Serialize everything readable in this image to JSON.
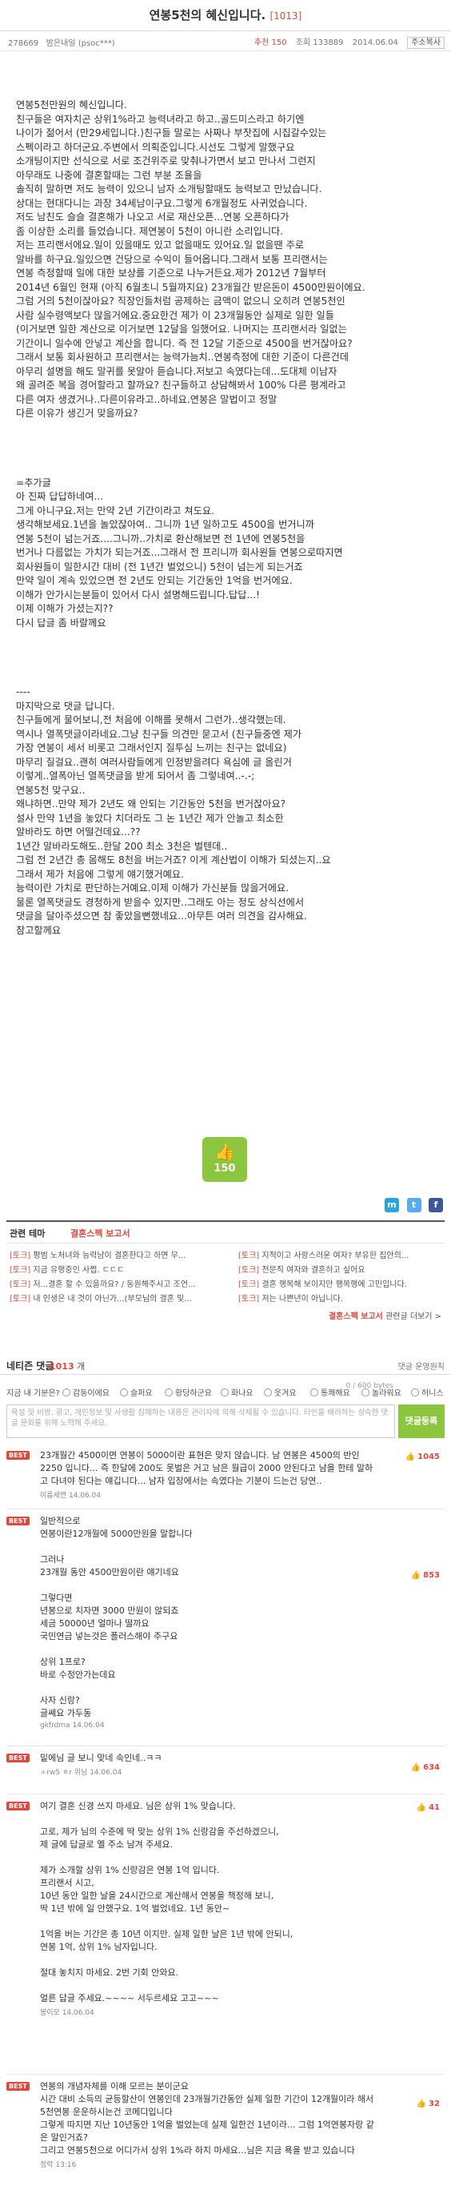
{
  "post": {
    "title": "연봉5천의 혜신입니다.",
    "count_badge": "[1013]",
    "id": "278669",
    "author": "밤은내일 (psoc***)",
    "recommend": "추천 150",
    "views": "조회 133889",
    "date": "2014.06.04",
    "copy_label": "주소복사"
  },
  "article": [
    "연봉5천만원의 혜신입니다.\n친구들은 여자치곤 상위1%라고 능력녀라고 하고..골드미스라고 하기엔\n나이가 젊어서 (만29세입니다.)친구들 말로는 사짜나 부잣집에 시집갈수있는\n스펙이라고 하더군요.주변에서 의획준입니다.시선도 그렇게 말했구요\n소개팅이지만 선식으로 서로 조건위주로 맞춰나가면서 보고 만나서 그런지\n아무래도 나중에 결혼할때는 그런 부분 조율을\n솔직히 말하면 저도 능력이 있으니 남자 소개팅할때도 능력보고 만났습니다.\n상대는 현대다니는 과장 34세남이구요.그렇게 6개월정도 사귀었습니다.\n저도 남친도 슬슬 결혼해가 나오고 서로 재산오픈...연봉 오픈하다가\n좀 이상한 소리를 들었습니다. 제연봉이 5천이 아니란 소리입니다.\n저는 프리랜서에요.일이 있을때도 있고 없을때도 있어요.일 없을땐 주로\n알바를 하구요.일있으면 건당으로 수익이 들어옵니다.그래서 보통 프리랜서는\n연봉 측정할때 일에 대한 보상를 기준으로 나누거든요.제가 2012년 7월부터\n2014년 6월인 현재 (아직 6월초니 5월까지요) 23개월간 받은돈이 4500만원이에요.\n그럼 거의 5천이잖아요? 직장인들처럼 공제하는 금액이 없으니 오히려 연봉5천인\n사람 실수령액보다 많을거에요.중요한건 제가 이 23개월동안 실제로 일한 일들\n(이거보면 일한 계산으로 이거보면 12달을 일했어요. 나머지는 프리랜서라 일없는\n기간이니 일수에 안넣고 계산을 합니다. 즉 전 12달 기준으로 4500을 번거잖아요?\n그래서 보통 회사원하고 프리랜서는 능력가늠치..연봉측정에 대한 기준이 다른건데\n아무리 설명을 해도 말귀를 못알아 듣습니다.저보고 속였다는데...도대체 이남자\n왜 골려준 복을 경어할라고 할까요? 친구들하고 상담해봐서 100% 다른 평계라고\n다른 여자 생겼거나..다른이유라고..하네요.연봉은 말법이고 정말\n다른 이유가 생긴거 맞을까요?",
    "=추가글\n아 진짜 답답하네여...\n그게 아니구요.저는 만약 2년 기간이라고 쳐도요.\n생각해보세요.1년을 놀았잖아여.. 그니까 1년 일하고도 4500을 번거니까\n연봉 5천이 넘는거죠....그니까..가치로 환산해보면 전 1년에 연봉5천을\n번거나 다름없는 가치가 되는거죠...그래서 전 프리니까 회사원들 연봉으로따지면\n회사원들이 일한시간 대비 (전 1년간 벌었으니) 5천이 넘는게 되는거죠\n만약 일이 계속 있었으면 전 2년도 안되는 기간동안 1억을 번거에요.\n이해가 안가시는분들이 있어서 다시 설명해드립니다.답답...!\n이제 이해가 가셨는지??\n다시 답글 좀 바랄께요",
    "----\n마지막으로 댓글 답니다.\n친구들에게 물어보니,전 처음에 이해를 못해서 그런가..생각했는데.\n역시나 열폭댓글이라네요.그냥 친구들 의견만 묻고서 (친구들중엔 제가\n가장 연봉이 세서 비롯고 그래서인지 질투심 느끼는 친구는 없네요)\n마무리 질걸요..괜히 여러사람들에게 인정받을려다 욕심에 글 올린거\n이렇게..열폭아닌 열폭댓글을 받게 되어서 좀 그렇네여..-.-;\n연봉5천 맞구요..\n왜냐하면..만약 제가 2년도 왜 안되는 기간동안 5천을 번거잖아요?\n설사 만약 1년을 놓았다 치더라도 그 논 1년간 제가 안놀고 최소한\n알바라도 하면 어떨건데요...??\n1년간 알바라도해도..한달 200 최소 3천은 벌텐데..\n그럼 전 2년간 총 몸해도 8천을 버는거죠? 이게 계산법이 이해가 되셨는지..요\n그래서 제가 처음에 그렇게 얘기했거예요.\n능력이란 가치로 판단하는거예요.이제 이해가 가신분들 많을거에요.\n물론 열폭댓글도 경청하게 받을수 있지만..그래도 아는 정도 상식선에서\n댓글을 달아주셨으면 참 좋았을뻔했네요...아무튼 여러 의견을 감사해요.\n참고할께요"
  ],
  "recommend_button": {
    "count": "150"
  },
  "related": {
    "label": "관련 테마",
    "theme": "결혼스펙 보고서",
    "items": [
      {
        "tag": "[토크]",
        "text": "평범 노처녀와 능력남이 결혼한다고 하면 무..."
      },
      {
        "tag": "[토크]",
        "text": "지금 유행중인 사쩝. ㄷㄷㄷ"
      },
      {
        "tag": "[토크]",
        "text": "저...결혼 할 수 있을까요? / 동원해주시고 조언..."
      },
      {
        "tag": "[토크]",
        "text": "내 인생은 내 것이 아닌가...(부모님의 결혼 및..."
      }
    ],
    "items_right": [
      {
        "tag": "[토크]",
        "text": "지적이고 사랑스러운 여자? 부유한 집안의..."
      },
      {
        "tag": "[토크]",
        "text": "전문직 여자와 결혼하고 싶어요"
      },
      {
        "tag": "[토크]",
        "text": "결혼 행복해 보이지만 행복행에 고민입니다."
      },
      {
        "tag": "[토크]",
        "text": "저는 나쁜년이 아닙니다."
      }
    ],
    "footer_theme": "결혼스펙 보고서",
    "footer_more": "관련글 더보기 >"
  },
  "comments_head": {
    "title": "네티즌 댓글",
    "count": "1013",
    "unit": "개",
    "right": "댓글 운영원칙"
  },
  "mood": {
    "label": "지금 내 기분은?",
    "options": [
      "감동이에요",
      "슬퍼요",
      "황당하군요",
      "화나요",
      "웃겨요",
      "통쾌해요",
      "놀라워요",
      "허니스"
    ]
  },
  "write": {
    "placeholder": "욕설 및 비방, 광고, 개인정보 및 사생활 침해하는 내용은 관리자에 의해 삭제될 수 있습니다. 타인을 배려하는 성숙한 댓글 문화를 위해 노력해 주세요.",
    "byte_counter": "0 / 600 bytes",
    "submit": "댓글등록"
  },
  "comments": [
    {
      "badge": "BEST",
      "text": "23개월간 4500이면 연봉이 5000이란 표현은 맞지 않습니다. 남 연봉은 4500의 반인 2250 입니다... 즉 한달에 200도 못벌은 거고 남은 월급이 2000 안된다고 남을 한테 말하고 다녀야 된다는 얘깁니다... 남자 입장에서는 속였다는 기분이 드는건 당연..",
      "who": "이름세번   14.06.04",
      "votes": "1045"
    },
    {
      "badge": "BEST",
      "text": "일반적으로\n연봉이란12개월에 5000만원을 말합니다\n\n그러나\n23개월 동안 4500만원이란 얘기네요\n\n그렇다면\n년봉으로 치자면 3000 만원이 않되죠\n세금 50000년 얼마나 떨까요\n국민연금 넣는것은 플러스해야 주구요\n\n상위 1프로?\n바로 수정안가는데요\n\n사자 신랑?\n글쎄요 가두동",
      "who": "gkfrdma   14.06.04",
      "votes": "853"
    },
    {
      "badge": "BEST",
      "text": "밑에님 글 보니 맞네 속인네..ㅋㅋ",
      "who": "ㅅrw5 ㅎr 위님   14.06.04",
      "votes": "634"
    },
    {
      "badge": "BEST",
      "text": "여기 결혼 신경 쓰지 마세요. 님은 상위 1% 맞습니다.\n\n고로, 제가 님의 수준에 딱 맞는 상위 1% 신랑감을 주선하겠으니,\n제 글에 답글로 멜 주소 남겨 주세요.\n\n제가 소개할 상위 1% 신랑감은 연봉 1억 입니다.\n프리랜서 시고,\n10년 동안 일한 날을 24시간으로 계산해서 연봉을 책정해 보니,\n딱 1년 밖에 일 안했구요. 1억 벌었네요. 1년 동안~\n\n1억을 버는 기간은 총 10년 이지만. 실제 일한 날은 1년 밖에 안되니,\n연봉 1억, 상위 1% 남자입니다.\n\n절대 놓치지 마세요. 2번 기회 안와요.\n\n얼른 답글 주세요.~~~~ 서두르세요 고고~~~",
      "who": "봉이모   14.06.04",
      "votes": "41"
    },
    {
      "badge": "BEST",
      "text": "연봉의 개념자체를 이해 모르는 분이군요\n시간 대비 소득의 균등할산이 연봉인데 23개월기간동안 실제 일한 기간이 12개월이라 해서 5천연봉 운운하시는건 코메디입니다\n그렇게 따지면 지난 10년동안 1억을 벌었는데 실제 일한건 1년이라... 그럼 1억연봉자랑 같은 말인거죠?\n그리고 연봉5천으로 어디가서 상위 1%라 하지 마세요...님은 지금 욕을 받고 있습니다",
      "who": "정락   13:16",
      "votes": "32"
    }
  ]
}
